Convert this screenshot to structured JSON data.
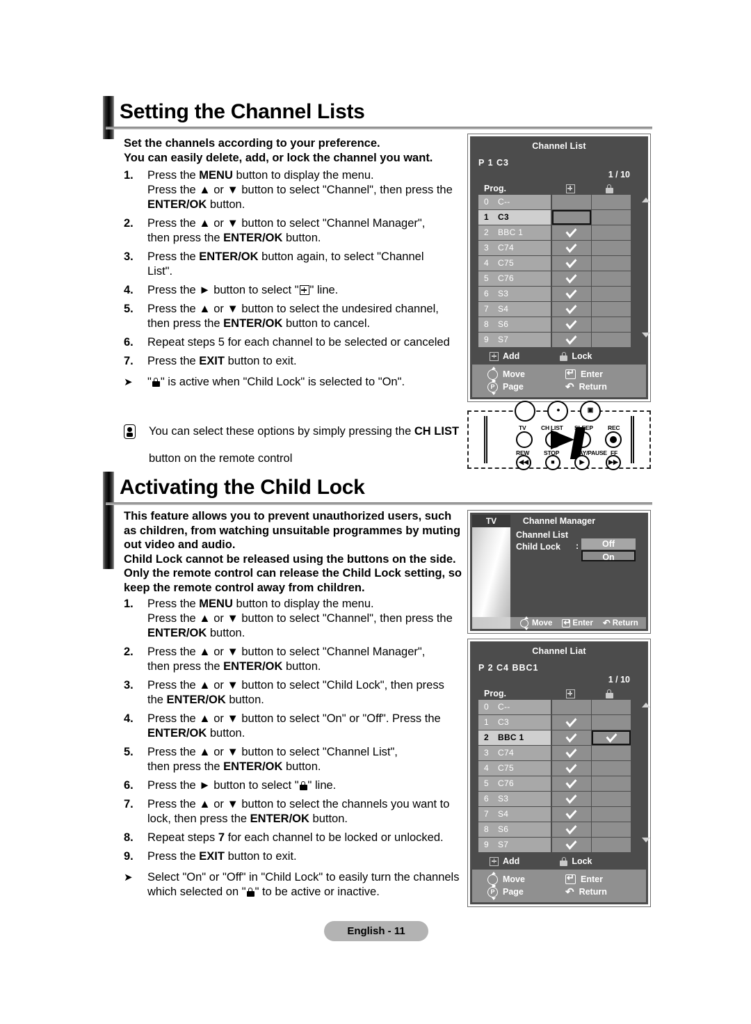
{
  "document": {
    "page_footer": "English - 11"
  },
  "section1": {
    "heading": "Setting the Channel Lists",
    "lead_line1": "Set the channels according to your preference.",
    "lead_line2": "You can easily delete, add, or lock the channel you want.",
    "steps": [
      {
        "num": "1.",
        "lines": [
          "Press the MENU button to display the menu.",
          "Press the ▲ or ▼ button to select \"Channel\", then press the",
          "ENTER/OK button."
        ]
      },
      {
        "num": "2.",
        "lines": [
          "Press the ▲ or ▼ button to select \"Channel Manager\",",
          "then press the ENTER/OK button."
        ]
      },
      {
        "num": "3.",
        "lines": [
          "Press the ENTER/OK button again, to select \"Channel",
          "List\"."
        ]
      },
      {
        "num": "4.",
        "lines": [
          "Press the ► button to select \" ⊞ \" line."
        ]
      },
      {
        "num": "5.",
        "lines": [
          "Press the ▲ or ▼ button to select the undesired channel,",
          "then press the ENTER/OK button to cancel."
        ]
      },
      {
        "num": "6.",
        "lines": [
          "Repeat steps 5 for each channel to be selected or canceled"
        ]
      },
      {
        "num": "7.",
        "lines": [
          "Press the EXIT button to exit."
        ]
      }
    ],
    "arrow_note": "\" ■ \" is active when \"Child Lock\" is selected to \"On\".",
    "note_line1": "You can select these options by simply pressing the CH LIST",
    "note_line2": "button on the remote control"
  },
  "section2": {
    "heading": "Activating the Child Lock",
    "lead_lines": [
      "This feature allows you to prevent unauthorized users, such",
      "as children, from watching unsuitable programmes by muting",
      "out video and audio.",
      "Child Lock cannot be released using the buttons on the side.",
      "Only the remote control can release the Child Lock setting, so",
      "keep the remote control away from children."
    ],
    "steps": [
      {
        "num": "1.",
        "lines": [
          "Press the MENU button to display the menu.",
          "Press the ▲ or ▼ button to select \"Channel\", then press the",
          "ENTER/OK button."
        ]
      },
      {
        "num": "2.",
        "lines": [
          "Press the ▲ or ▼ button to select \"Channel Manager\",",
          "then press the ENTER/OK button."
        ]
      },
      {
        "num": "3.",
        "lines": [
          "Press the ▲ or ▼ button to select \"Child Lock\", then press",
          "the ENTER/OK button."
        ]
      },
      {
        "num": "4.",
        "lines": [
          "Press the ▲ or ▼ button to select \"On\" or \"Off\". Press the",
          "ENTER/OK button."
        ]
      },
      {
        "num": "5.",
        "lines": [
          "Press the ▲ or ▼ button to select \"Channel List\",",
          "then press the ENTER/OK button."
        ]
      },
      {
        "num": "6.",
        "lines": [
          "Press the ► button to select \" ■ \" line."
        ]
      },
      {
        "num": "7.",
        "lines": [
          "Press the ▲ or ▼ button to select the channels you want to",
          "lock, then press the ENTER/OK button."
        ]
      },
      {
        "num": "8.",
        "lines": [
          "Repeat steps 7 for each channel to be locked or unlocked."
        ]
      },
      {
        "num": "9.",
        "lines": [
          "Press the EXIT button to exit."
        ]
      }
    ],
    "arrow_note_line1": "Select \"On\" or \"Off\" in \"Child Lock\" to easily turn the channels",
    "arrow_note_line2": "which selected on \" ■ \" to be active or inactive."
  },
  "osd_channel_list_top": {
    "title": "Channel List",
    "prog_line": "P  1   C3",
    "page_indicator": "1 / 10",
    "col_prog": "Prog.",
    "col_add_icon": "plus-box-icon",
    "col_lock_icon": "lock-icon",
    "rows": [
      {
        "num": "0",
        "name": "C--",
        "add": false,
        "lock": false,
        "selected": false,
        "add_boxed": false,
        "lock_boxed": false
      },
      {
        "num": "1",
        "name": "C3",
        "add": false,
        "lock": false,
        "selected": true,
        "add_boxed": true,
        "lock_boxed": false
      },
      {
        "num": "2",
        "name": "BBC 1",
        "add": true,
        "lock": false,
        "selected": false,
        "add_boxed": false,
        "lock_boxed": false
      },
      {
        "num": "3",
        "name": "C74",
        "add": true,
        "lock": false,
        "selected": false,
        "add_boxed": false,
        "lock_boxed": false
      },
      {
        "num": "4",
        "name": "C75",
        "add": true,
        "lock": false,
        "selected": false,
        "add_boxed": false,
        "lock_boxed": false
      },
      {
        "num": "5",
        "name": "C76",
        "add": true,
        "lock": false,
        "selected": false,
        "add_boxed": false,
        "lock_boxed": false
      },
      {
        "num": "6",
        "name": "S3",
        "add": true,
        "lock": false,
        "selected": false,
        "add_boxed": false,
        "lock_boxed": false
      },
      {
        "num": "7",
        "name": "S4",
        "add": true,
        "lock": false,
        "selected": false,
        "add_boxed": false,
        "lock_boxed": false
      },
      {
        "num": "8",
        "name": "S6",
        "add": true,
        "lock": false,
        "selected": false,
        "add_boxed": false,
        "lock_boxed": false
      },
      {
        "num": "9",
        "name": "S7",
        "add": true,
        "lock": false,
        "selected": false,
        "add_boxed": false,
        "lock_boxed": false
      }
    ],
    "legend_add": "Add",
    "legend_lock": "Lock",
    "footer": {
      "move": "Move",
      "enter": "Enter",
      "page": "Page",
      "return": "Return"
    }
  },
  "osd_channel_manager": {
    "source_label": "TV",
    "title": "Channel Manager",
    "item_channel_list": "Channel List",
    "item_child_lock": "Child Lock",
    "colon": ":",
    "option_off": "Off",
    "option_on": "On",
    "footer": {
      "move": "Move",
      "enter": "Enter",
      "return": "Return"
    }
  },
  "osd_channel_list_bottom": {
    "title": "Channel Liat",
    "prog_line": "P  2   C4       BBC1",
    "page_indicator": "1 / 10",
    "col_prog": "Prog.",
    "col_add_icon": "plus-box-icon",
    "col_lock_icon": "lock-icon",
    "rows": [
      {
        "num": "0",
        "name": "C--",
        "add": false,
        "lock": false,
        "selected": false,
        "add_boxed": false,
        "lock_boxed": false
      },
      {
        "num": "1",
        "name": "C3",
        "add": true,
        "lock": false,
        "selected": false,
        "add_boxed": false,
        "lock_boxed": false
      },
      {
        "num": "2",
        "name": "BBC 1",
        "add": true,
        "lock": true,
        "selected": true,
        "add_boxed": false,
        "lock_boxed": true
      },
      {
        "num": "3",
        "name": "C74",
        "add": true,
        "lock": false,
        "selected": false,
        "add_boxed": false,
        "lock_boxed": false
      },
      {
        "num": "4",
        "name": "C75",
        "add": true,
        "lock": false,
        "selected": false,
        "add_boxed": false,
        "lock_boxed": false
      },
      {
        "num": "5",
        "name": "C76",
        "add": true,
        "lock": false,
        "selected": false,
        "add_boxed": false,
        "lock_boxed": false
      },
      {
        "num": "6",
        "name": "S3",
        "add": true,
        "lock": false,
        "selected": false,
        "add_boxed": false,
        "lock_boxed": false
      },
      {
        "num": "7",
        "name": "S4",
        "add": true,
        "lock": false,
        "selected": false,
        "add_boxed": false,
        "lock_boxed": false
      },
      {
        "num": "8",
        "name": "S6",
        "add": true,
        "lock": false,
        "selected": false,
        "add_boxed": false,
        "lock_boxed": false
      },
      {
        "num": "9",
        "name": "S7",
        "add": true,
        "lock": false,
        "selected": false,
        "add_boxed": false,
        "lock_boxed": false
      }
    ],
    "legend_add": "Add",
    "legend_lock": "Lock",
    "footer": {
      "move": "Move",
      "enter": "Enter",
      "page": "Page",
      "return": "Return"
    }
  },
  "remote": {
    "labels_top": [
      "TV",
      "CH LIST",
      "SLEEP",
      "REC"
    ],
    "labels_bottom": [
      "REW",
      "STOP",
      "PLAY/PAUSE",
      "FF"
    ],
    "highlight": "ch-list-button"
  },
  "colors": {
    "osd_bg": "#4c4c4c",
    "osd_row": "#a8a8a8",
    "osd_cell": "#8f8f8f",
    "osd_selected_row": "#cfcfcf",
    "osd_footer": "#909090",
    "badge_bg": "#b3b3b3"
  }
}
